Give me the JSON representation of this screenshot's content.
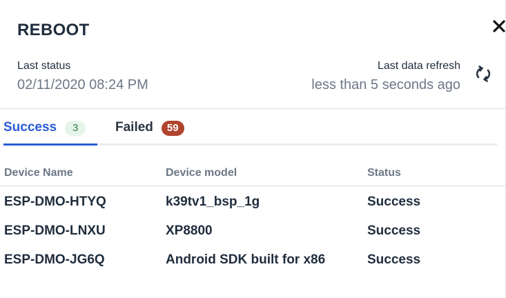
{
  "dialog": {
    "title": "REBOOT",
    "close_icon": "close-icon"
  },
  "status": {
    "last_status_label": "Last status",
    "last_status_value": "02/11/2020 08:24 PM",
    "last_refresh_label": "Last data refresh",
    "last_refresh_value": "less than 5 seconds ago",
    "refresh_icon": "refresh-icon"
  },
  "tabs": [
    {
      "label": "Success",
      "count": "3",
      "active": true,
      "badge_color": "#e6f5ea"
    },
    {
      "label": "Failed",
      "count": "59",
      "active": false,
      "badge_color": "#b0442e"
    }
  ],
  "table": {
    "columns": [
      "Device Name",
      "Device model",
      "Status"
    ],
    "rows": [
      {
        "name": "ESP-DMO-HTYQ",
        "model": "k39tv1_bsp_1g",
        "status": "Success"
      },
      {
        "name": "ESP-DMO-LNXU",
        "model": "XP8800",
        "status": "Success"
      },
      {
        "name": "ESP-DMO-JG6Q",
        "model": "Android SDK built for x86",
        "status": "Success"
      }
    ]
  },
  "colors": {
    "accent": "#2a5bd7",
    "success_badge_text": "#3a7d4b",
    "failed_badge": "#b0442e"
  }
}
